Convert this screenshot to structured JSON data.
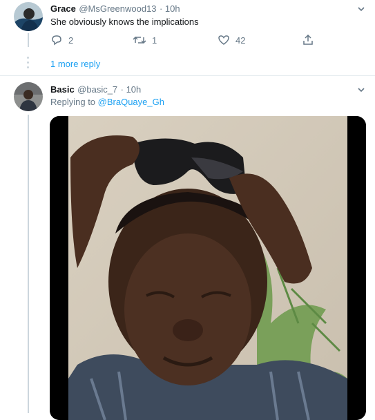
{
  "tweet1": {
    "name": "Grace",
    "handle": "@MsGreenwood13",
    "time": "· 10h",
    "text": "She obviously knows the implications",
    "replies": "2",
    "retweets": "1",
    "likes": "42"
  },
  "thread": {
    "more_replies": "1 more reply"
  },
  "tweet2": {
    "name": "Basic",
    "handle": "@basic_7",
    "time": "· 10h",
    "replying_prefix": "Replying to ",
    "replying_to": "@BraQuaye_Gh"
  },
  "icons": {
    "reply": "reply-icon",
    "retweet": "retweet-icon",
    "like": "heart-icon",
    "share": "share-icon",
    "caret": "chevron-down-icon"
  },
  "colors": {
    "link": "#1da1f2",
    "muted": "#657786",
    "text": "#14171a"
  }
}
